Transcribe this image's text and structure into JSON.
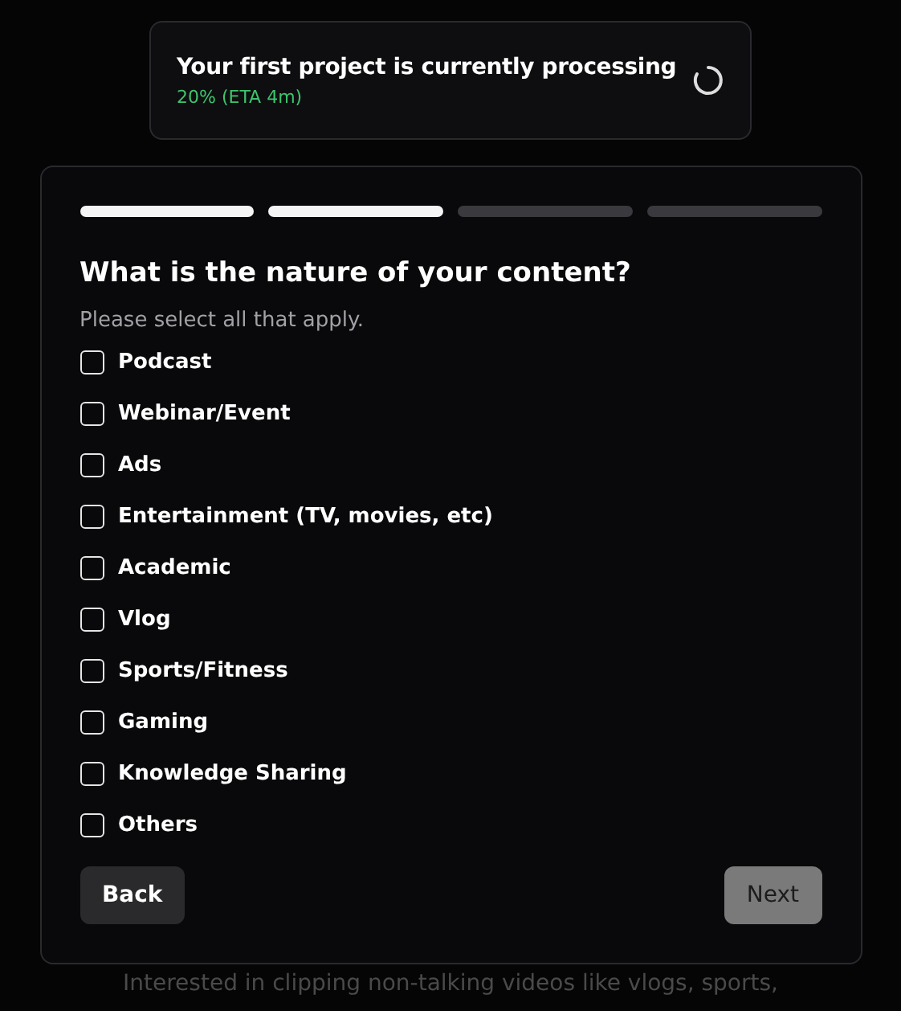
{
  "toast": {
    "title": "Your first project is currently processing",
    "progress": "20% (ETA 4m)",
    "in_progress": true
  },
  "steps": [
    {
      "done": true
    },
    {
      "done": true
    },
    {
      "done": false
    },
    {
      "done": false
    }
  ],
  "question": "What is the nature of your content?",
  "hint": "Please select all that apply.",
  "options": [
    {
      "label": "Podcast",
      "checked": false
    },
    {
      "label": "Webinar/Event",
      "checked": false
    },
    {
      "label": "Ads",
      "checked": false
    },
    {
      "label": "Entertainment (TV, movies, etc)",
      "checked": false
    },
    {
      "label": "Academic",
      "checked": false
    },
    {
      "label": "Vlog",
      "checked": false
    },
    {
      "label": "Sports/Fitness",
      "checked": false
    },
    {
      "label": "Gaming",
      "checked": false
    },
    {
      "label": "Knowledge Sharing",
      "checked": false
    },
    {
      "label": "Others",
      "checked": false
    }
  ],
  "back_button": {
    "label": "Back",
    "disabled": false
  },
  "next_button": {
    "label": "Next",
    "disabled": true
  },
  "background_text": "Interested in clipping non-talking videos like vlogs, sports,"
}
